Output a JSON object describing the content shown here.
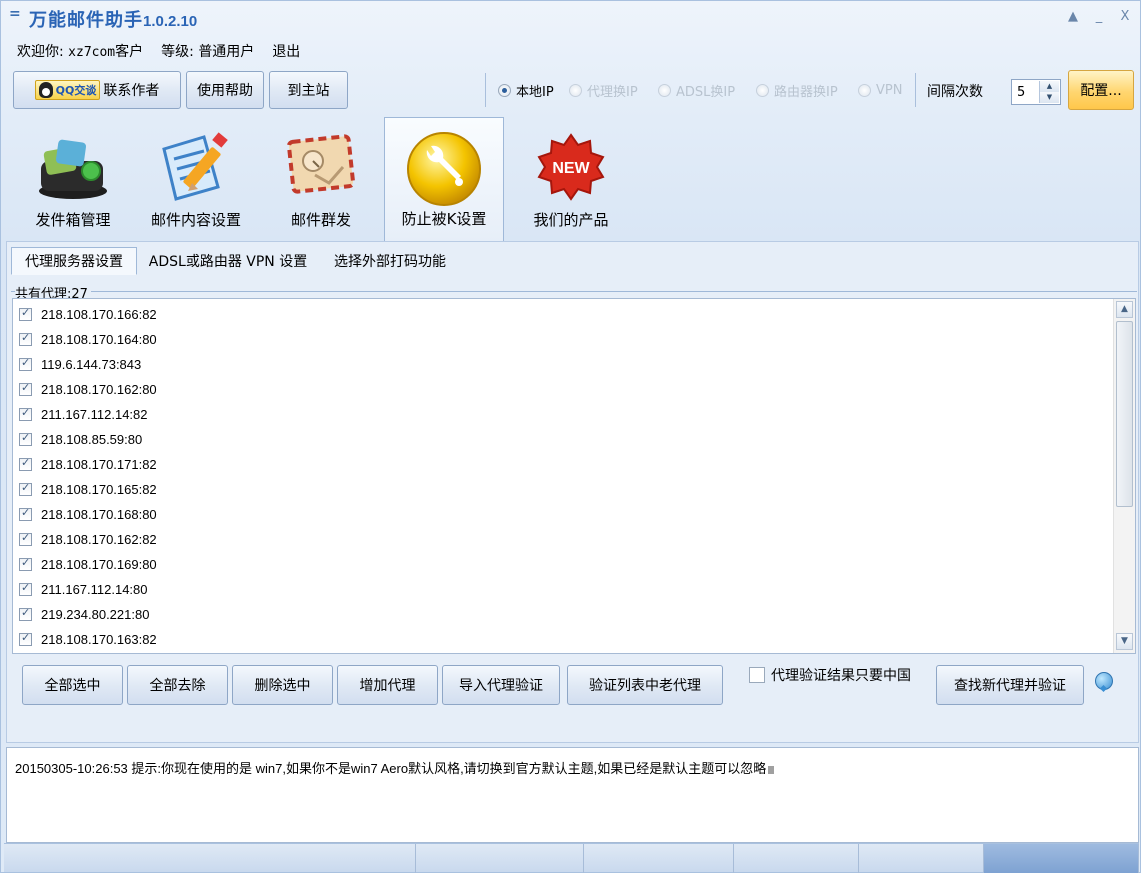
{
  "window": {
    "title": "万能邮件助手",
    "version": "1.0.2.10",
    "controls": [
      "▲",
      "_",
      "X"
    ]
  },
  "welcome": {
    "greeting": "欢迎你:",
    "user": "xz7com",
    "user_suffix": "客户",
    "level_label": "等级:",
    "level": "普通用户",
    "logout": "退出"
  },
  "topbar": {
    "qq_badge": "QQ交谈",
    "contact": "联系作者",
    "help": "使用帮助",
    "home": "到主站",
    "ip_modes": [
      {
        "label": "本地IP",
        "selected": true,
        "enabled": true
      },
      {
        "label": "代理换IP",
        "selected": false,
        "enabled": false
      },
      {
        "label": "ADSL换IP",
        "selected": false,
        "enabled": false
      },
      {
        "label": "路由器换IP",
        "selected": false,
        "enabled": false
      },
      {
        "label": "VPN",
        "selected": false,
        "enabled": false
      }
    ],
    "interval_label": "间隔次数",
    "interval_value": "5",
    "config": "配置..."
  },
  "toolbar": [
    {
      "label": "发件箱管理",
      "icon": "outbox-icon"
    },
    {
      "label": "邮件内容设置",
      "icon": "document-edit-icon"
    },
    {
      "label": "邮件群发",
      "icon": "envelope-icon"
    },
    {
      "label": "防止被K设置",
      "icon": "wrench-icon",
      "active": true
    },
    {
      "label": "我们的产品",
      "icon": "new-badge-icon"
    }
  ],
  "subtabs": [
    "代理服务器设置",
    "ADSL或路由器 VPN 设置",
    "选择外部打码功能"
  ],
  "proxy": {
    "count_label": "共有代理:27",
    "items": [
      "218.108.170.166:82",
      "218.108.170.164:80",
      "119.6.144.73:843",
      "218.108.170.162:80",
      "211.167.112.14:82",
      "218.108.85.59:80",
      "218.108.170.171:82",
      "218.108.170.165:82",
      "218.108.170.168:80",
      "218.108.170.162:82",
      "218.108.170.169:80",
      "211.167.112.14:80",
      "219.234.80.221:80",
      "218.108.170.163:82"
    ]
  },
  "actions": {
    "select_all": "全部选中",
    "clear_all": "全部去除",
    "delete_selected": "删除选中",
    "add_proxy": "增加代理",
    "import_verify": "导入代理验证",
    "verify_old": "验证列表中老代理",
    "china_only": "代理验证结果只要中国",
    "find_new": "查找新代理并验证"
  },
  "log": {
    "timestamp": "20150305-10:26:53",
    "message": "提示:你现在使用的是 win7,如果你不是win7 Aero默认风格,请切换到官方默认主题,如果已经是默认主题可以忽略"
  }
}
